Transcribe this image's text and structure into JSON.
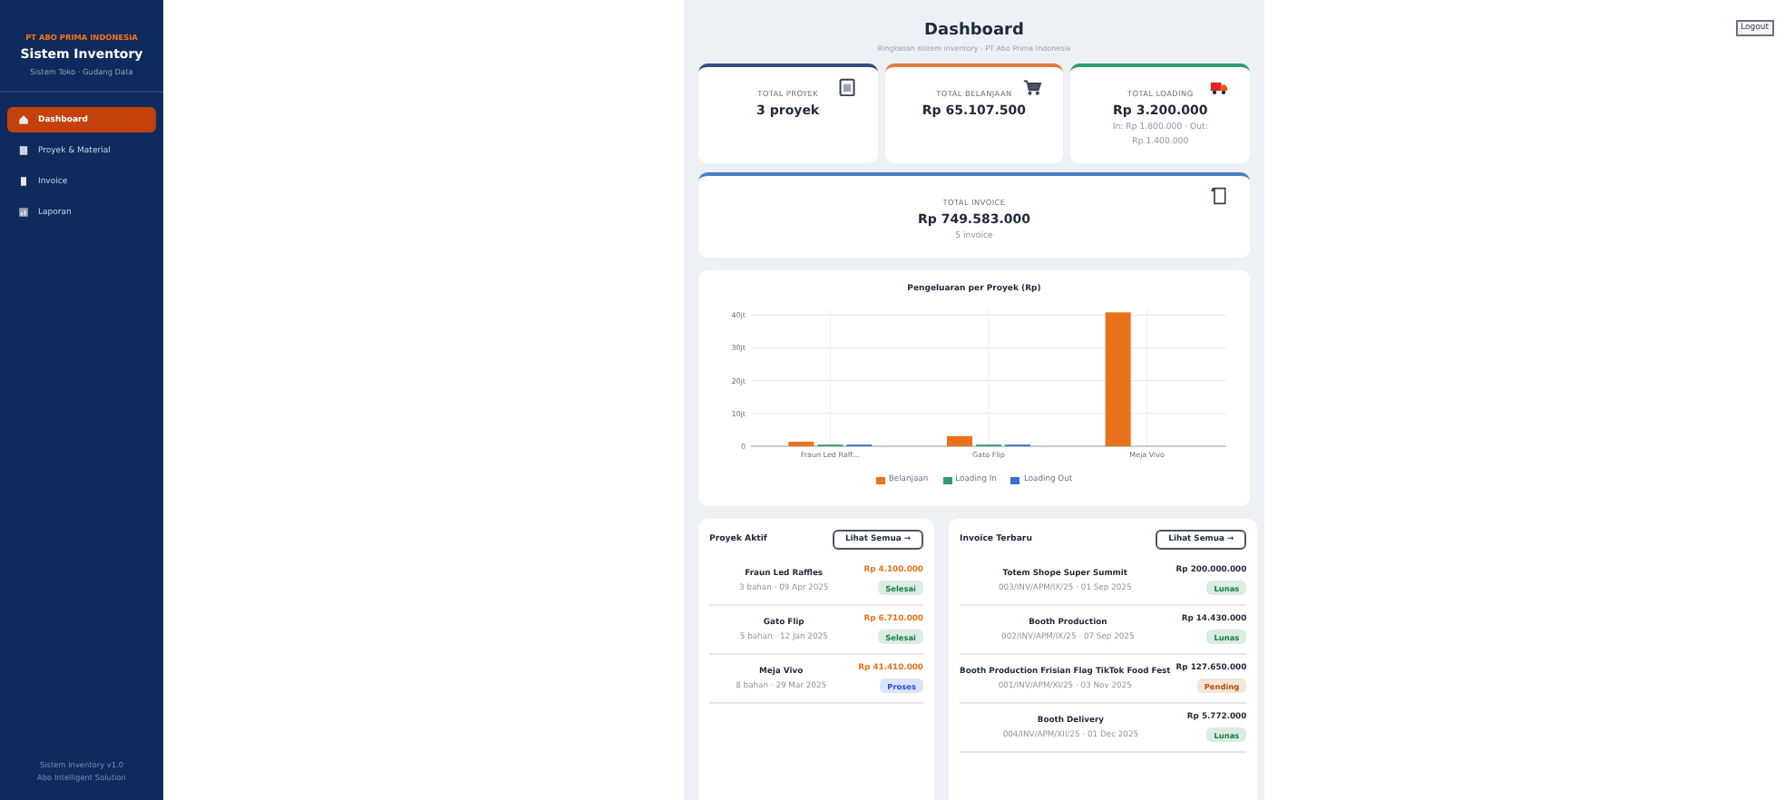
{
  "sidebar": {
    "company": "PT ABO PRIMA INDONESIA",
    "title": "Sistem Inventory",
    "subtitle": "Sistem Toko · Gudang Data",
    "items": [
      {
        "label": "Dashboard",
        "selected": true
      },
      {
        "label": "Proyek & Material",
        "selected": false
      },
      {
        "label": "Invoice",
        "selected": false
      },
      {
        "label": "Laporan",
        "selected": false
      }
    ],
    "footer": [
      "Sistem Inventory v1.0",
      "Abo Intelligent Solution"
    ]
  },
  "logout": "Logout",
  "header": {
    "title": "Dashboard",
    "subtitle": "Ringkasan sistem inventory · PT Abo Prima Indonesia"
  },
  "stats": [
    {
      "label": "TOTAL PROYEK",
      "value": "3 proyek",
      "color": "#334e7a"
    },
    {
      "label": "TOTAL BELANJAAN",
      "value": "Rp 65.107.500",
      "color": "#e07b39"
    },
    {
      "label": "TOTAL LOADING",
      "value": "Rp 3.200.000",
      "notes": [
        "In: Rp 1.800.000 · Out:",
        "Rp 1.400.000"
      ],
      "color": "#2f9e6e"
    },
    {
      "label": "TOTAL INVOICE",
      "value": "Rp 749.583.000",
      "notes": [
        "5 invoice"
      ],
      "color": "#4a7fc1"
    }
  ],
  "chart": {
    "chart_data": {
      "type": "bar",
      "title": "Pengeluaran per Proyek (Rp)",
      "categories": [
        "Fraun Led Raff...",
        "Gato Flip",
        "Meja Vivo"
      ],
      "series": [
        {
          "name": "Belanjaan",
          "color": "#e8731a",
          "values": [
            1.4,
            3.1,
            40.8
          ]
        },
        {
          "name": "Loading In",
          "color": "#2f9e6e",
          "values": [
            0.5,
            0.5,
            0
          ]
        },
        {
          "name": "Loading Out",
          "color": "#3b6fc9",
          "values": [
            0.5,
            0.5,
            0
          ]
        }
      ],
      "grid": true,
      "ylim": [
        0,
        42
      ],
      "yticks": [
        {
          "value": 0,
          "label": "0"
        },
        {
          "value": 10,
          "label": "10jt"
        },
        {
          "value": 20,
          "label": "20jt"
        },
        {
          "value": 30,
          "label": "30jt"
        },
        {
          "value": 40,
          "label": "40jt"
        }
      ]
    }
  },
  "projects": {
    "title": "Proyek Aktif",
    "button": "Lihat Semua →",
    "rows": [
      {
        "name": "Fraun Led Raffles",
        "meta": "3 bahan · 09 Apr 2025",
        "amount": "Rp 4.100.000",
        "status": "Selesai",
        "color": "#15803d"
      },
      {
        "name": "Gato Flip",
        "meta": "5 bahan · 12 Jan 2025",
        "amount": "Rp 6.710.000",
        "status": "Selesai",
        "color": "#15803d"
      },
      {
        "name": "Meja Vivo",
        "meta": "8 bahan · 29 Mar 2025",
        "amount": "Rp 41.410.000",
        "status": "Proses",
        "color": "#1d4ed8"
      }
    ]
  },
  "invoices": {
    "title": "Invoice Terbaru",
    "button": "Lihat Semua →",
    "rows": [
      {
        "name": "Totem Shope Super Summit",
        "meta": "003/INV/APM/IX/25 · 01 Sep 2025",
        "amount": "Rp 200.000.000",
        "status": "Lunas",
        "color": "#15803d"
      },
      {
        "name": "Booth Production",
        "meta": "002/INV/APM/IX/25 · 07 Sep 2025",
        "amount": "Rp 14.430.000",
        "status": "Lunas",
        "color": "#15803d"
      },
      {
        "name": "Booth Production Frisian Flag TikTok Food Fest",
        "meta": "001/INV/APM/XI/25 · 03 Nov 2025",
        "amount": "Rp 127.650.000",
        "status": "Pending",
        "color": "#b45309"
      },
      {
        "name": "Booth Delivery",
        "meta": "004/INV/APM/XII/25 · 01 Dec 2025",
        "amount": "Rp 5.772.000",
        "status": "Lunas",
        "color": "#15803d"
      }
    ]
  }
}
